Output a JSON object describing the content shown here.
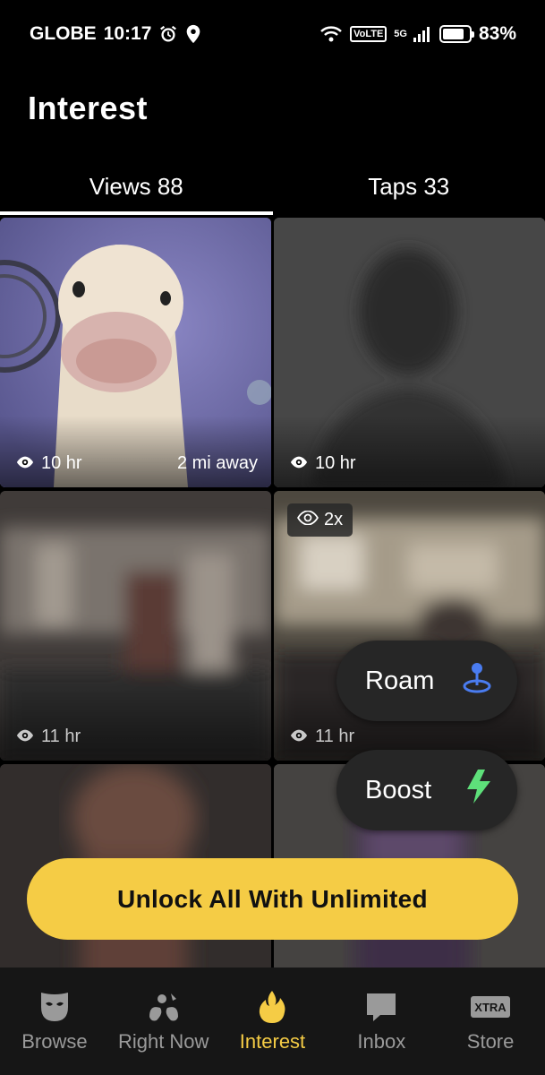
{
  "status_bar": {
    "carrier": "GLOBE",
    "time": "10:17",
    "volte": "VoLTE",
    "network": "5G",
    "battery": "83%"
  },
  "header": {
    "title": "Interest"
  },
  "tabs": [
    {
      "label": "Views 88",
      "active": true
    },
    {
      "label": "Taps 33",
      "active": false
    }
  ],
  "cards": [
    {
      "time": "10 hr",
      "distance": "2 mi away"
    },
    {
      "time": "10 hr",
      "distance": ""
    },
    {
      "time": "11 hr",
      "distance": ""
    },
    {
      "time": "11 hr",
      "distance": "",
      "badge": "2x"
    }
  ],
  "fabs": {
    "roam": {
      "label": "Roam"
    },
    "boost": {
      "label": "Boost"
    }
  },
  "unlock_button": {
    "label": "Unlock All With Unlimited"
  },
  "bottom_nav": [
    {
      "label": "Browse",
      "icon": "mask-icon"
    },
    {
      "label": "Right Now",
      "icon": "splash-icon"
    },
    {
      "label": "Interest",
      "icon": "flame-icon",
      "active": true
    },
    {
      "label": "Inbox",
      "icon": "chat-icon"
    },
    {
      "label": "Store",
      "icon": "xtra-icon",
      "badge": "XTRA"
    }
  ],
  "colors": {
    "accent": "#f5cc45",
    "roam_icon": "#4a7cf0",
    "boost_icon": "#5ee07a"
  }
}
